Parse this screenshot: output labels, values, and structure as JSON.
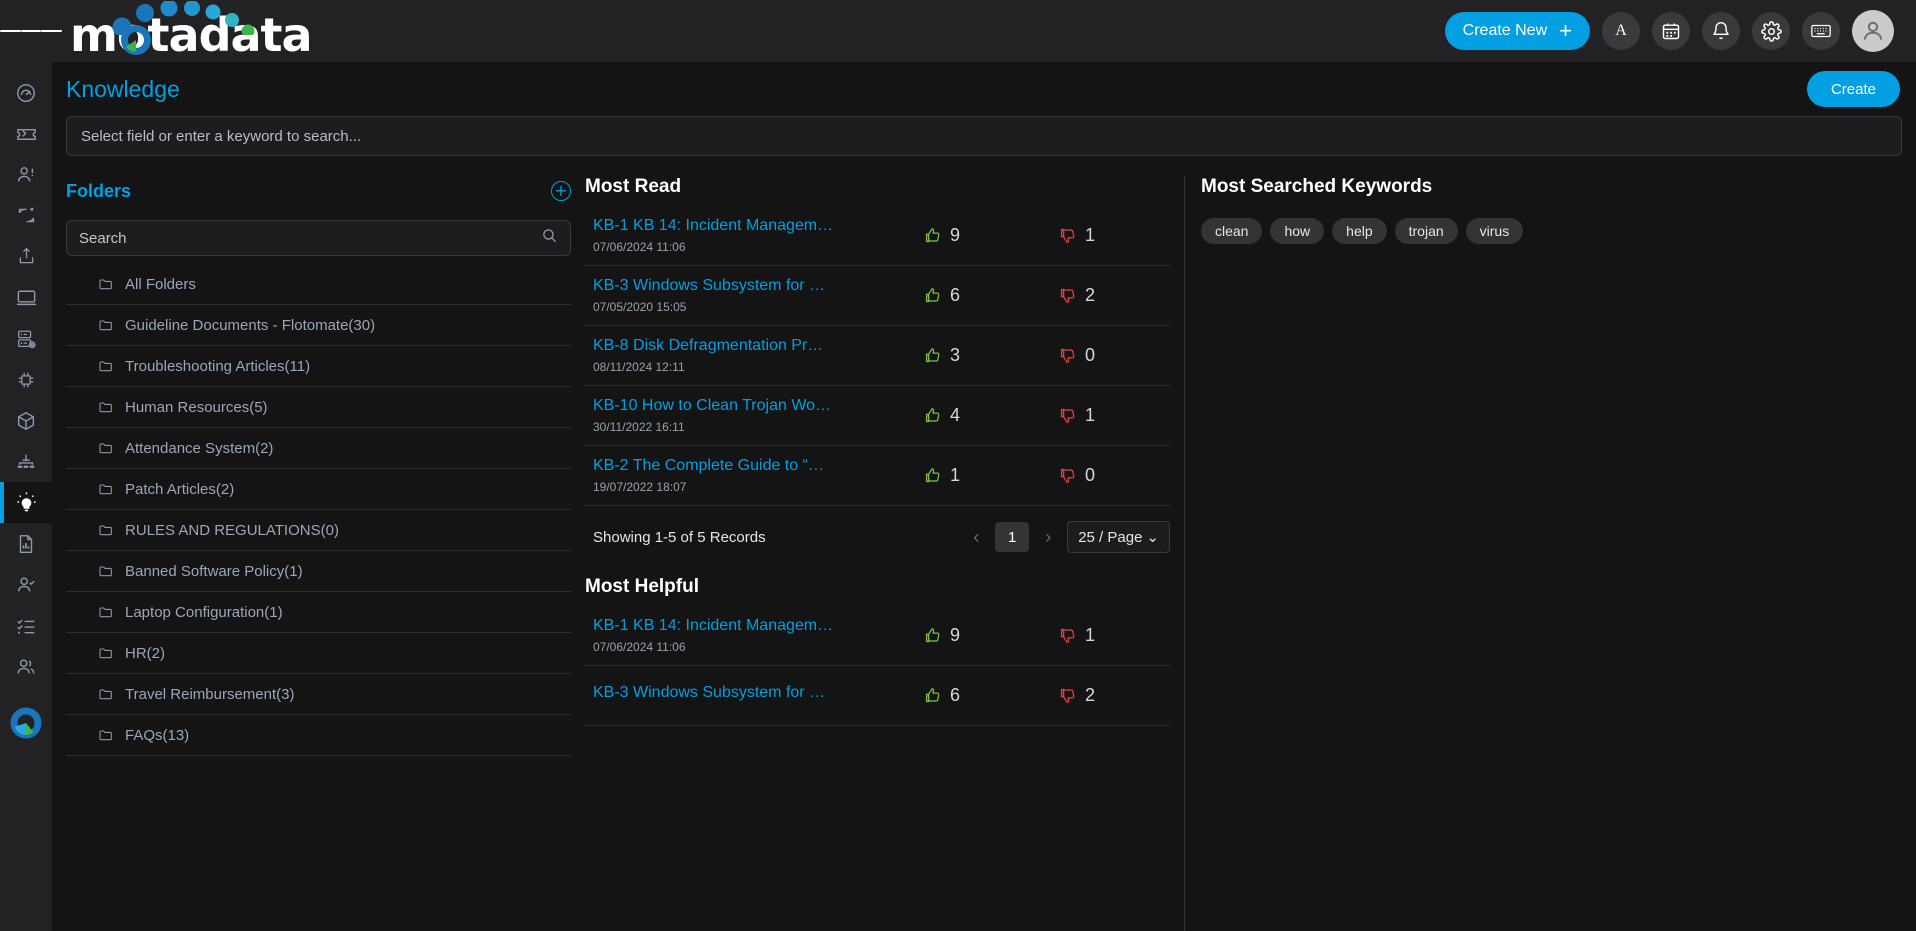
{
  "topbar": {
    "menu_icon": "hamburger-icon",
    "brand": "motadata",
    "create_new_label": "Create New",
    "create_new_plus": "+",
    "buttons": [
      {
        "name": "announcement-button",
        "icon": "letter-a-icon",
        "label": "A"
      },
      {
        "name": "calendar-button",
        "icon": "calendar-icon",
        "label": ""
      },
      {
        "name": "notifications-button",
        "icon": "bell-icon",
        "label": ""
      },
      {
        "name": "settings-button",
        "icon": "gear-icon",
        "label": ""
      },
      {
        "name": "keyboard-shortcuts-button",
        "icon": "keyboard-icon",
        "label": ""
      }
    ],
    "avatar_icon": "user-avatar-icon"
  },
  "rail": {
    "items": [
      {
        "name": "sidebar-item-dashboard",
        "icon": "speedometer-icon",
        "active": false
      },
      {
        "name": "sidebar-item-tickets",
        "icon": "ticket-icon",
        "active": false
      },
      {
        "name": "sidebar-item-requester",
        "icon": "user-alert-icon",
        "active": false
      },
      {
        "name": "sidebar-item-change",
        "icon": "refresh-loop-icon",
        "active": false
      },
      {
        "name": "sidebar-item-release",
        "icon": "upload-box-icon",
        "active": false
      },
      {
        "name": "sidebar-item-assets",
        "icon": "monitor-icon",
        "active": false
      },
      {
        "name": "sidebar-item-cmdb",
        "icon": "server-gear-icon",
        "active": false
      },
      {
        "name": "sidebar-item-patch",
        "icon": "chip-icon",
        "active": false
      },
      {
        "name": "sidebar-item-software",
        "icon": "cube-icon",
        "active": false
      },
      {
        "name": "sidebar-item-workflow",
        "icon": "hierarchy-icon",
        "active": false
      },
      {
        "name": "sidebar-item-knowledge",
        "icon": "lightbulb-icon",
        "active": true
      },
      {
        "name": "sidebar-item-reports",
        "icon": "report-chart-icon",
        "active": false
      },
      {
        "name": "sidebar-item-approvals",
        "icon": "user-check-icon",
        "active": false
      },
      {
        "name": "sidebar-item-tasks",
        "icon": "checklist-icon",
        "active": false
      },
      {
        "name": "sidebar-item-users",
        "icon": "users-icon",
        "active": false
      }
    ],
    "logo_icon": "motadata-donut-icon"
  },
  "page": {
    "title": "Knowledge",
    "create_button": "Create",
    "search_placeholder": "Select field or enter a keyword to search..."
  },
  "folders": {
    "title": "Folders",
    "add_icon": "plus-circle-icon",
    "search_placeholder": "Search",
    "search_icon": "search-icon",
    "items": [
      {
        "label": "All Folders"
      },
      {
        "label": "Guideline Documents - Flotomate(30)"
      },
      {
        "label": "Troubleshooting Articles(11)"
      },
      {
        "label": "Human Resources(5)"
      },
      {
        "label": "Attendance System(2)"
      },
      {
        "label": "Patch Articles(2)"
      },
      {
        "label": "RULES AND REGULATIONS(0)"
      },
      {
        "label": "Banned Software Policy(1)"
      },
      {
        "label": "Laptop Configuration(1)"
      },
      {
        "label": "HR(2)"
      },
      {
        "label": "Travel Reimbursement(3)"
      },
      {
        "label": "FAQs(13)"
      }
    ]
  },
  "most_read": {
    "title": "Most Read",
    "rows": [
      {
        "title": "KB-1 KB 14: Incident Managem…",
        "date": "07/06/2024 11:06",
        "up": "9",
        "down": "1"
      },
      {
        "title": "KB-3 Windows Subsystem for …",
        "date": "07/05/2020 15:05",
        "up": "6",
        "down": "2"
      },
      {
        "title": "KB-8 Disk Defragmentation Pr…",
        "date": "08/11/2024 12:11",
        "up": "3",
        "down": "0"
      },
      {
        "title": "KB-10 How to Clean Trojan Wo…",
        "date": "30/11/2022 16:11",
        "up": "4",
        "down": "1"
      },
      {
        "title": "KB-2 The Complete Guide to “…",
        "date": "19/07/2022 18:07",
        "up": "1",
        "down": "0"
      }
    ],
    "pager": {
      "showing": "Showing 1-5 of 5 Records",
      "prev_icon": "chevron-left-icon",
      "next_icon": "chevron-right-icon",
      "current_page": "1",
      "page_size": "25 / Page",
      "page_size_caret": "chevron-down-icon"
    }
  },
  "most_helpful": {
    "title": "Most Helpful",
    "rows": [
      {
        "title": "KB-1 KB 14: Incident Managem…",
        "date": "07/06/2024 11:06",
        "up": "9",
        "down": "1"
      },
      {
        "title": "KB-3 Windows Subsystem for …",
        "date": "",
        "up": "6",
        "down": "2"
      }
    ]
  },
  "most_searched": {
    "title": "Most Searched Keywords",
    "keywords": [
      "clean",
      "how",
      "help",
      "trojan",
      "virus"
    ]
  },
  "colors": {
    "accent": "#029fe3",
    "up_vote": "#7ac143",
    "down_vote": "#e8413c",
    "page_bg": "#141414",
    "chrome_bg": "#222225",
    "folder_label": "#9ba6bb"
  }
}
